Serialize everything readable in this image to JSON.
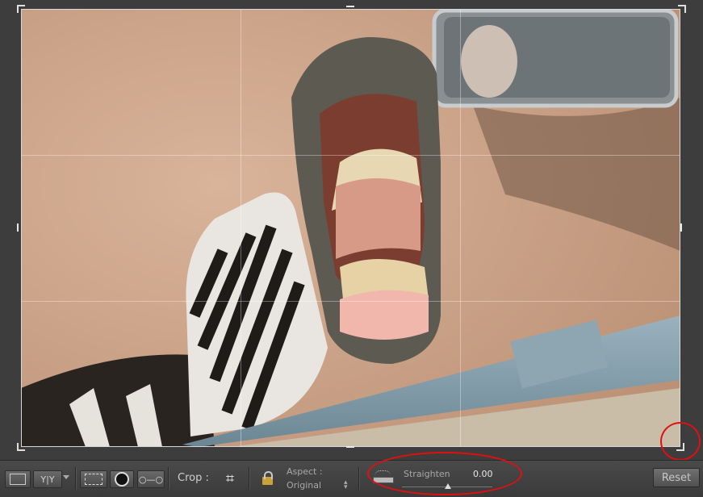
{
  "toolbar": {
    "crop_label": "Crop :",
    "aspect_label": "Aspect :",
    "aspect_value": "Original",
    "straighten_label": "Straighten",
    "straighten_value": "0.00",
    "reset_label": "Reset",
    "view_mode_label": "Y|Y"
  },
  "colors": {
    "annotation": "#e01010",
    "panel": "#3c3c3c"
  },
  "icons": [
    "rectangle-view-icon",
    "before-after-icon",
    "dropdown-arrow-icon",
    "crop-overlay-icon",
    "spot-removal-icon",
    "red-eye-icon",
    "crop-tool-icon",
    "lock-icon",
    "chevron-updown-icon",
    "straighten-level-icon",
    "slider-thumb-icon"
  ]
}
